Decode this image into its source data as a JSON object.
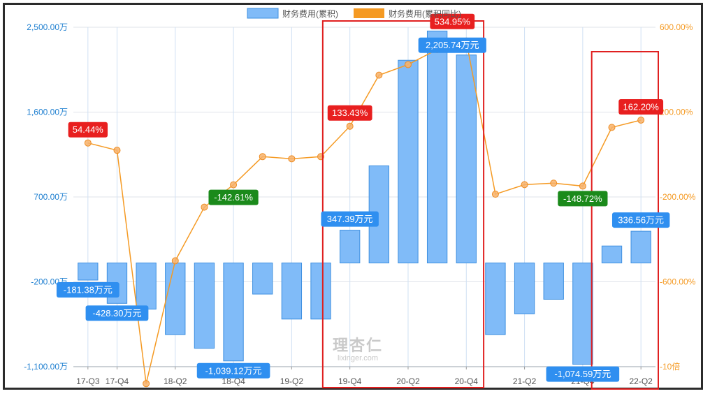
{
  "chart_data": {
    "type": "bar",
    "categories": [
      "17-Q3",
      "17-Q4",
      "18-Q1",
      "18-Q2",
      "18-Q3",
      "18-Q4",
      "19-Q1",
      "19-Q2",
      "19-Q3",
      "19-Q4",
      "20-Q1",
      "20-Q2",
      "20-Q3",
      "20-Q4",
      "21-Q1",
      "21-Q2",
      "21-Q3",
      "21-Q4",
      "22-Q1",
      "22-Q2"
    ],
    "x_tick_labels": [
      "17-Q3",
      "17-Q4",
      "",
      "18-Q2",
      "",
      "18-Q4",
      "",
      "19-Q2",
      "",
      "19-Q4",
      "",
      "20-Q2",
      "",
      "20-Q4",
      "",
      "21-Q2",
      "",
      "21-Q4",
      "",
      "22-Q2"
    ],
    "series": [
      {
        "name": "财务费用(累积)",
        "type": "bar",
        "axis": "left",
        "unit": "万",
        "color": "#80bbf8",
        "border_color": "#3d8fe0",
        "values": [
          -181.38,
          -428.3,
          -490,
          -760,
          -905,
          -1039.12,
          -330,
          -595,
          -595,
          347.39,
          1030,
          2150,
          2460,
          2205.74,
          -760,
          -540,
          -385,
          -1074.59,
          180,
          336.56
        ]
      },
      {
        "name": "财务费用(累积同比)",
        "type": "line",
        "axis": "right",
        "unit": "%",
        "color": "#f59a23",
        "values": [
          54.44,
          20,
          -1080,
          -501,
          -248,
          -142.61,
          -10,
          -20,
          -10,
          133.43,
          374,
          424,
          495,
          534.95,
          -187,
          -142,
          -135,
          -148.72,
          128,
          162.2
        ]
      }
    ],
    "left_axis": {
      "min": -1100,
      "max": 2500,
      "ticks": [
        -1100,
        -200,
        700,
        1600,
        2500
      ],
      "tick_labels": [
        "-1,100.00万",
        "-200.00万",
        "700.00万",
        "1,600.00万",
        "2,500.00万"
      ]
    },
    "right_axis": {
      "min": -1000,
      "max": 600,
      "ticks": [
        -1000,
        -600,
        -200,
        200,
        600
      ],
      "tick_labels": [
        "-10倍",
        "-600.00%",
        "-200.00%",
        "200.00%",
        "600.00%"
      ]
    },
    "data_labels": [
      {
        "series": 0,
        "index": 0,
        "text": "-181.38万元",
        "color": "#2f8ff0"
      },
      {
        "series": 0,
        "index": 1,
        "text": "-428.30万元",
        "color": "#2f8ff0"
      },
      {
        "series": 0,
        "index": 5,
        "text": "-1,039.12万元",
        "color": "#2f8ff0"
      },
      {
        "series": 0,
        "index": 9,
        "text": "347.39万元",
        "color": "#2f8ff0"
      },
      {
        "series": 0,
        "index": 13,
        "text": "2,205.74万元",
        "color": "#2f8ff0"
      },
      {
        "series": 0,
        "index": 17,
        "text": "-1,074.59万元",
        "color": "#2f8ff0"
      },
      {
        "series": 0,
        "index": 19,
        "text": "336.56万元",
        "color": "#2f8ff0"
      },
      {
        "series": 1,
        "index": 0,
        "text": "54.44%",
        "color": "#e81f1f"
      },
      {
        "series": 1,
        "index": 5,
        "text": "-142.61%",
        "color": "#1b8a1b"
      },
      {
        "series": 1,
        "index": 9,
        "text": "133.43%",
        "color": "#e81f1f"
      },
      {
        "series": 1,
        "index": 13,
        "text": "534.95%",
        "color": "#e81f1f"
      },
      {
        "series": 1,
        "index": 17,
        "text": "-148.72%",
        "color": "#1b8a1b"
      },
      {
        "series": 1,
        "index": 19,
        "text": "162.20%",
        "color": "#e81f1f"
      }
    ],
    "highlight_boxes": [
      {
        "from": "19-Q4",
        "to": "20-Q4",
        "color": "#e02020"
      },
      {
        "from": "22-Q1",
        "to": "22-Q2",
        "color": "#e02020"
      }
    ],
    "watermark": {
      "cn": "理杏仁",
      "en": "lixinger.com"
    },
    "grid": true,
    "legend_position": "top-center"
  }
}
